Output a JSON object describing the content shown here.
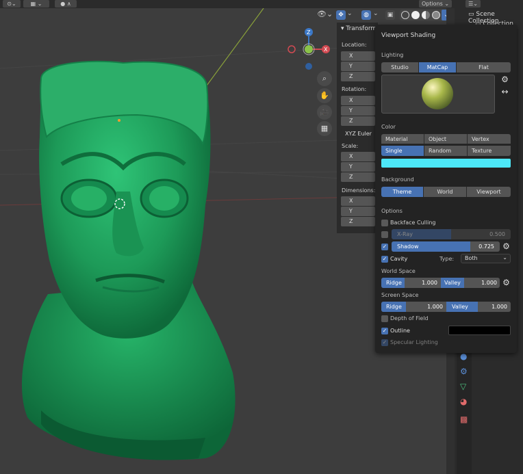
{
  "header": {
    "options_label": "Options"
  },
  "outliner": {
    "title": "Scene Collection",
    "collection": "Collection"
  },
  "transform_panel": {
    "tab_label": "Transform",
    "location_label": "Location:",
    "rotation_label": "Rotation:",
    "rotation_mode": "XYZ Euler",
    "scale_label": "Scale:",
    "dimensions_label": "Dimensions:",
    "axes": [
      "X",
      "Y",
      "Z"
    ]
  },
  "shading": {
    "title": "Viewport Shading",
    "lighting_label": "Lighting",
    "lighting_options": [
      "Studio",
      "MatCap",
      "Flat"
    ],
    "lighting_selected": "MatCap",
    "color_label": "Color",
    "color_options": [
      "Material",
      "Object",
      "Vertex",
      "Single",
      "Random",
      "Texture"
    ],
    "color_selected": "Single",
    "single_color": "#4de8f8",
    "background_label": "Background",
    "background_options": [
      "Theme",
      "World",
      "Viewport"
    ],
    "background_selected": "Theme",
    "options_label": "Options",
    "backface_culling": "Backface Culling",
    "xray_label": "X-Ray",
    "xray_value": "0.500",
    "xray_fraction": 0.5,
    "shadow_label": "Shadow",
    "shadow_value": "0.725",
    "shadow_fraction": 0.725,
    "cavity_label": "Cavity",
    "type_label": "Type:",
    "type_value": "Both",
    "world_space_label": "World Space",
    "screen_space_label": "Screen Space",
    "ridge_label": "Ridge",
    "valley_label": "Valley",
    "world_ridge": "1.000",
    "world_valley": "1.000",
    "screen_ridge": "1.000",
    "screen_valley": "1.000",
    "depth_of_field": "Depth of Field",
    "outline_label": "Outline",
    "outline_color": "#000000",
    "specular_label": "Specular Lighting"
  },
  "colors": {
    "accent": "#4772b3",
    "model": "#1f9a5a"
  }
}
